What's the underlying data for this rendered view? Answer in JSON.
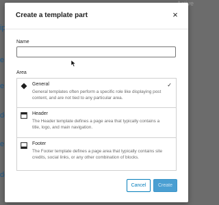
{
  "background": {
    "hints": [
      "ip",
      "e",
      "e",
      "de",
      "e",
      "de"
    ],
    "top_right_text": "Active"
  },
  "modal": {
    "title": "Create a template part",
    "name_label": "Name",
    "name_value": "",
    "area_label": "Area",
    "options": [
      {
        "title": "General",
        "description": "General templates often perform a specific role like displaying post content, and are not tied to any particular area.",
        "icon": "diamond-icon",
        "selected": true
      },
      {
        "title": "Header",
        "description": "The Header template defines a page area that typically contains a title, logo, and main navigation.",
        "icon": "header-layout-icon",
        "selected": false
      },
      {
        "title": "Footer",
        "description": "The Footer template defines a page area that typically contains site credits, social links, or any other combination of blocks.",
        "icon": "footer-layout-icon",
        "selected": false
      }
    ],
    "check_mark": "✓",
    "close_symbol": "×",
    "cancel_label": "Cancel",
    "create_label": "Create"
  },
  "colors": {
    "accent": "#007cba",
    "overlay": "#6c6c6c"
  }
}
